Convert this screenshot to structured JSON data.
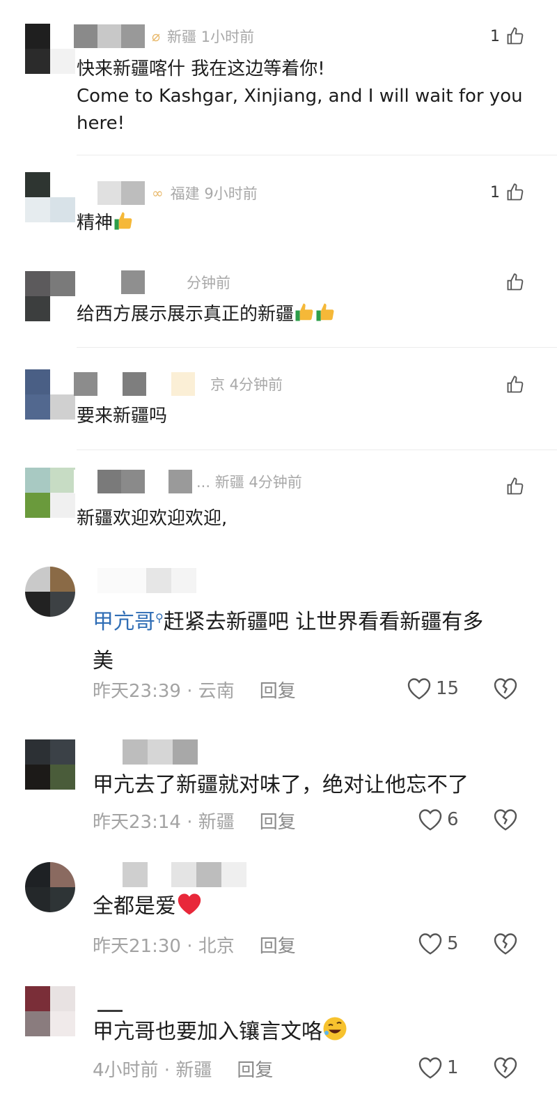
{
  "comments_a": [
    {
      "meta": "新疆 1小时前",
      "text_lines": [
        "快来新疆喀什 我在这边等着你!",
        "Come to Kashgar, Xinjiang, and I will wait for you",
        "here!"
      ],
      "likes": "1"
    },
    {
      "meta": "福建 9小时前",
      "text": "精神",
      "likes": "1"
    },
    {
      "meta": "分钟前",
      "text": "给西方展示展示真正的新疆",
      "likes": ""
    },
    {
      "meta": "京 4分钟前",
      "text": "要来新疆吗",
      "likes": ""
    },
    {
      "meta": "... 新疆 4分钟前",
      "text": "新疆欢迎欢迎欢迎,",
      "likes": ""
    }
  ],
  "comments_b": [
    {
      "mention": "甲亢哥",
      "text_line1": "赶紧去新疆吧 让世界看看新疆有多",
      "text_line2": "美",
      "time_loc": "昨天23:39 · 云南",
      "reply": "回复",
      "likes": "15"
    },
    {
      "text": "甲亢去了新疆就对味了，绝对让他忘不了",
      "time_loc": "昨天23:14 · 新疆",
      "reply": "回复",
      "likes": "6"
    },
    {
      "text": "全都是爱",
      "time_loc": "昨天21:30 · 北京",
      "reply": "回复",
      "likes": "5"
    },
    {
      "text": "甲亢哥也要加入镶言文咯",
      "time_loc": "4小时前 · 新疆",
      "reply": "回复",
      "likes": "1"
    }
  ],
  "colors": {
    "meta_gray": "#a8a8a8",
    "mention_blue": "#2f6db5",
    "heart_red": "#e8283a",
    "badge_gold": "#e8b86a"
  },
  "icons": {
    "like": "thumbs-up-outline-icon",
    "heart": "heart-outline-icon",
    "dislike": "broken-heart-icon",
    "emoji_thumb": "thumbs-up-emoji",
    "emoji_heart": "red-heart-emoji",
    "emoji_laugh": "rolling-laughing-emoji"
  }
}
